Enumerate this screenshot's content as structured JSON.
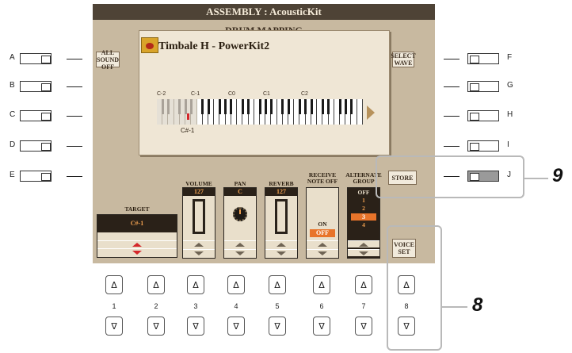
{
  "screen": {
    "title": "ASSEMBLY : AcousticKit",
    "subtitle": "DRUM MAPPING",
    "all_sound_off": "ALL\nSOUND OFF",
    "select_wave": "SELECT\nWAVE",
    "store": "STORE",
    "voice_set": "VOICE\nSET",
    "voice_name": "Timbale H - PowerKit2",
    "octave_labels": [
      "C-2",
      "C-1",
      "C0",
      "C1",
      "C2"
    ],
    "selected_note": "C#-1",
    "target_label": "TARGET",
    "target_value": "C#-1",
    "volume_label": "VOLUME",
    "volume_value": "127",
    "pan_label": "PAN",
    "pan_value": "C",
    "reverb_label": "REVERB",
    "reverb_value": "127",
    "receive_label": "RECEIVE\nNOTE OFF",
    "receive_on": "ON",
    "receive_off": "OFF",
    "alt_group_label": "ALTERNATE\nGROUP",
    "alt_group_options": [
      "OFF",
      "1",
      "2",
      "3",
      "4"
    ],
    "alt_group_selected": "3"
  },
  "left_buttons": [
    "A",
    "B",
    "C",
    "D",
    "E"
  ],
  "right_buttons": [
    "F",
    "G",
    "H",
    "I",
    "J"
  ],
  "bottom_numbers": [
    "1",
    "2",
    "3",
    "4",
    "5",
    "6",
    "7",
    "8"
  ],
  "up_glyph": "Δ",
  "down_glyph": "∇",
  "step_8": "8",
  "step_9": "9",
  "colors": {
    "title_bar": "#4e4336",
    "screen_bg": "#c8b9a0",
    "value_text": "#f0a050",
    "accent_red": "#d4262a"
  }
}
